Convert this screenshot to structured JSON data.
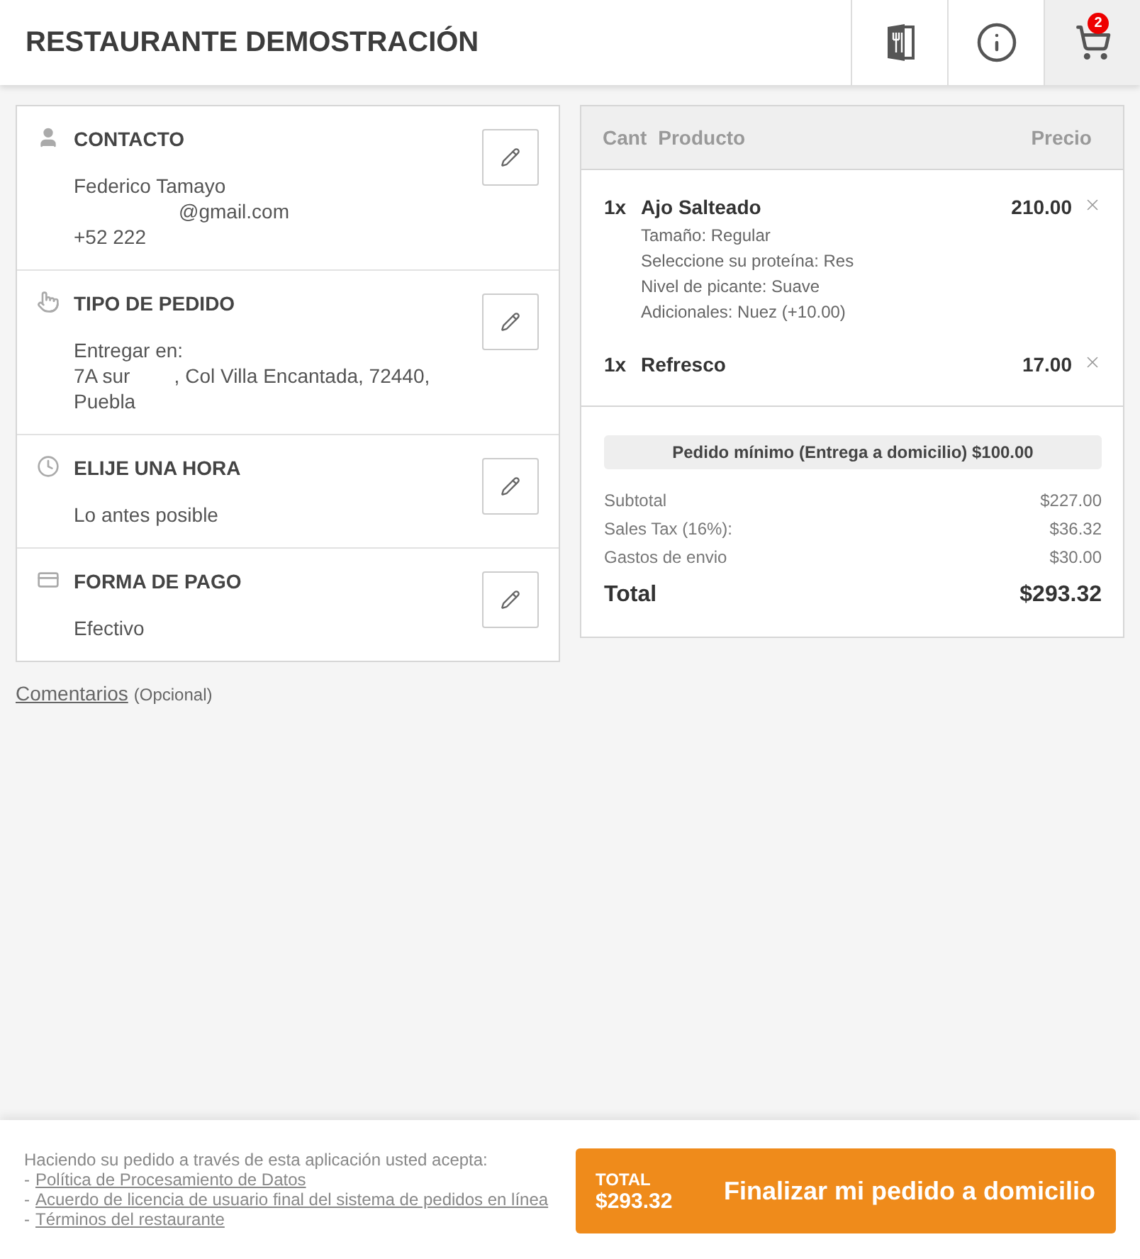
{
  "header": {
    "title": "RESTAURANTE DEMOSTRACIÓN",
    "buttons": [
      {
        "kind": "menu",
        "selected": false
      },
      {
        "kind": "info",
        "selected": false
      },
      {
        "kind": "cart",
        "selected": true,
        "badge": "2"
      }
    ]
  },
  "sections": [
    {
      "kind": "contact",
      "title": "CONTACTO",
      "lines": [
        "Federico Tamayo",
        "@gmail.com",
        "+52 222"
      ]
    },
    {
      "kind": "order-type",
      "title": "TIPO DE PEDIDO",
      "lines": [
        "Entregar en:",
        "7A sur        , Col Villa Encantada, 72440,",
        "Puebla"
      ]
    },
    {
      "kind": "time",
      "title": "ELIJE UNA HORA",
      "lines": [
        "Lo antes posible"
      ]
    },
    {
      "kind": "payment",
      "title": "FORMA DE PAGO",
      "lines": [
        "Efectivo"
      ]
    }
  ],
  "comments": {
    "label": "Comentarios",
    "note": "(Opcional)"
  },
  "cart": {
    "columns": [
      "Cant",
      "Producto",
      "Precio"
    ],
    "items": [
      {
        "qty": "1x",
        "name": "Ajo Salteado",
        "price": "210.00",
        "options": [
          "Tamaño: Regular",
          "Seleccione su proteína: Res",
          "Nivel de picante: Suave",
          "Adicionales: Nuez (+10.00)"
        ]
      },
      {
        "qty": "1x",
        "name": "Refresco",
        "price": "17.00"
      }
    ],
    "minimum": "Pedido mínimo (Entrega a domicilio) $100.00",
    "summary": [
      {
        "label": "Subtotal",
        "value": "$227.00"
      },
      {
        "label": "Sales Tax (16%):",
        "value": "$36.32"
      },
      {
        "label": "Gastos de envio",
        "value": "$30.00"
      }
    ],
    "total": {
      "label": "Total",
      "value": "$293.32"
    }
  },
  "footer": {
    "intro": "Haciendo su pedido a través de esta aplicación usted acepta:",
    "links": [
      "Política de Procesamiento de Datos",
      "Acuerdo de licencia de usuario final del sistema de pedidos en línea",
      "Términos del restaurante"
    ],
    "dash": "-",
    "checkout": {
      "total_label": "TOTAL",
      "total_value": "$293.32",
      "label": "Finalizar mi pedido a domicilio"
    }
  }
}
